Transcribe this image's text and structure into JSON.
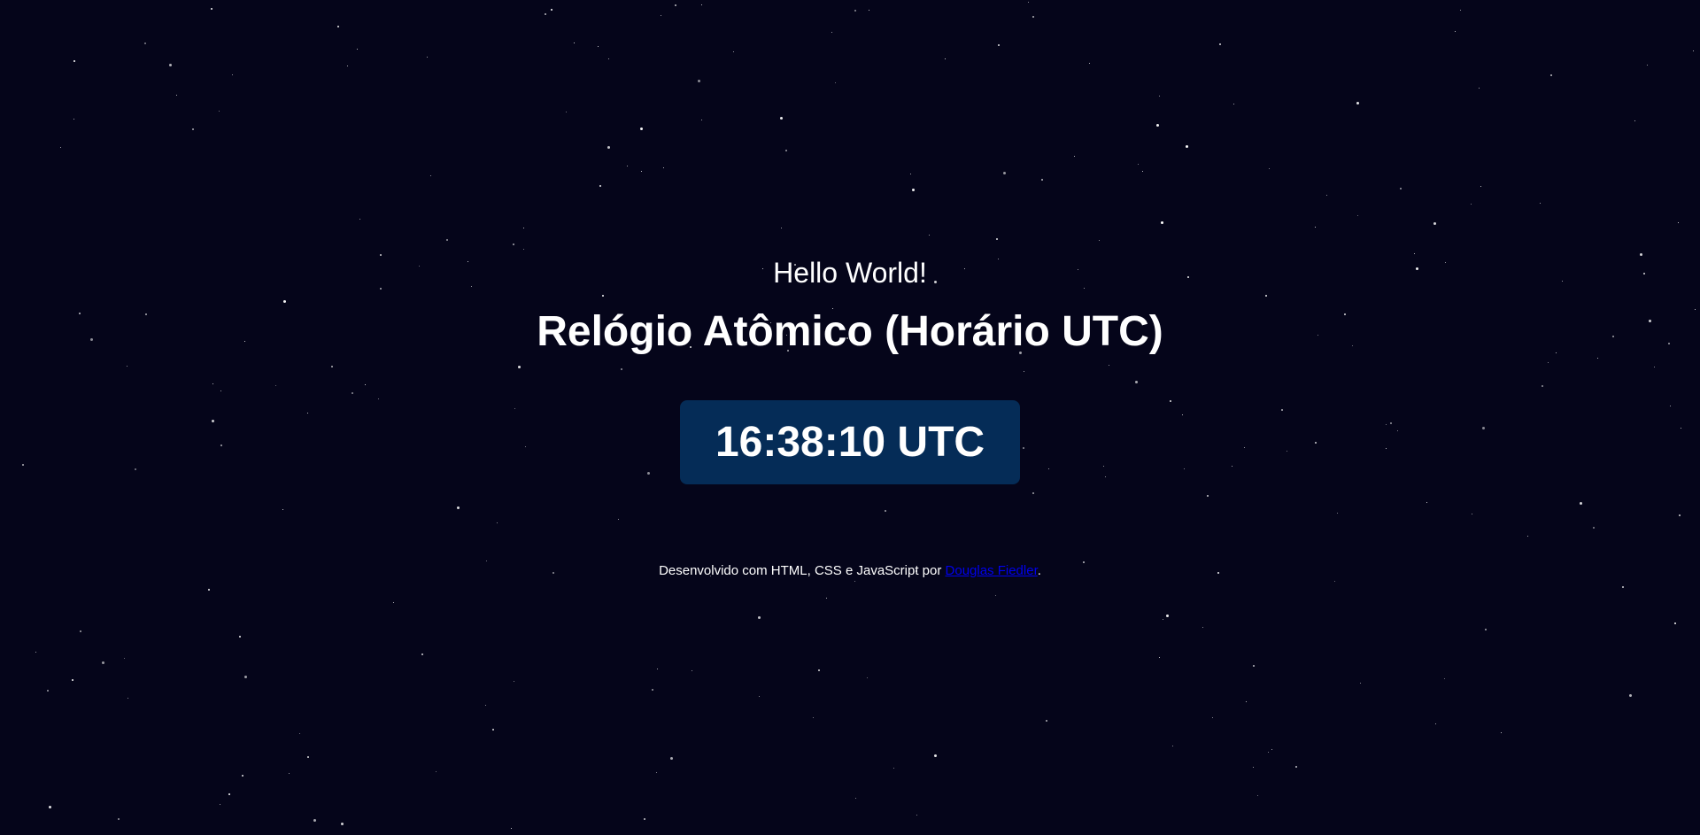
{
  "page": {
    "greeting": "Hello World!",
    "title": "Relógio Atômico (Horário UTC)",
    "clock": {
      "time": "16:38:10 UTC"
    },
    "footer": {
      "prefix": "Desenvolvido com HTML, CSS e JavaScript por ",
      "author_link": "Douglas Fiedler",
      "suffix": "."
    }
  },
  "colors": {
    "background": "#05051a",
    "clock_box": "#052c57",
    "text": "#ffffff",
    "link": "#0000ee",
    "star": "#ffffff"
  }
}
